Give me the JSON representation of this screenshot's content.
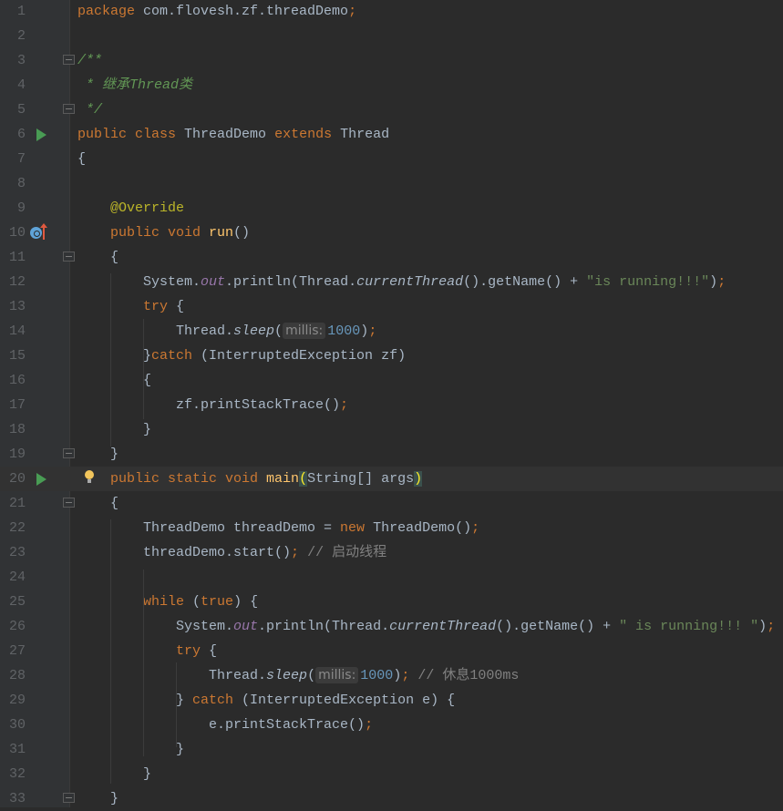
{
  "editor": {
    "current_line": 20,
    "lines": [
      {
        "n": "1",
        "tokens": [
          {
            "t": "package ",
            "c": "k"
          },
          {
            "t": "com.flovesh.zf.threadDemo",
            "c": "d"
          },
          {
            "t": ";",
            "c": "semi"
          }
        ]
      },
      {
        "n": "2",
        "tokens": []
      },
      {
        "n": "3",
        "fold": true,
        "tokens": [
          {
            "t": "/**",
            "c": "c"
          }
        ]
      },
      {
        "n": "4",
        "tokens": [
          {
            "t": " * 继承Thread类",
            "c": "c"
          }
        ]
      },
      {
        "n": "5",
        "fold": true,
        "tokens": [
          {
            "t": " */",
            "c": "c"
          }
        ]
      },
      {
        "n": "6",
        "run": true,
        "tokens": [
          {
            "t": "public class ",
            "c": "k"
          },
          {
            "t": "ThreadDemo ",
            "c": "d"
          },
          {
            "t": "extends ",
            "c": "k"
          },
          {
            "t": "Thread",
            "c": "d"
          }
        ]
      },
      {
        "n": "7",
        "tokens": [
          {
            "t": "{",
            "c": "d"
          }
        ]
      },
      {
        "n": "8",
        "tokens": []
      },
      {
        "n": "9",
        "tokens": [
          {
            "t": "    ",
            "c": "d"
          },
          {
            "t": "@Override",
            "c": "a"
          }
        ]
      },
      {
        "n": "10",
        "override": true,
        "tokens": [
          {
            "t": "    public void ",
            "c": "k"
          },
          {
            "t": "run",
            "c": "f"
          },
          {
            "t": "()",
            "c": "d"
          }
        ]
      },
      {
        "n": "11",
        "fold": true,
        "tokens": [
          {
            "t": "    {",
            "c": "d"
          }
        ]
      },
      {
        "n": "12",
        "tokens": [
          {
            "t": "        System.",
            "c": "d"
          },
          {
            "t": "out",
            "c": "sf"
          },
          {
            "t": ".println(Thread.",
            "c": "d"
          },
          {
            "t": "currentThread",
            "c": "sm"
          },
          {
            "t": "().getName() + ",
            "c": "d"
          },
          {
            "t": "\"is running!!!\"",
            "c": "s"
          },
          {
            "t": ")",
            "c": "d"
          },
          {
            "t": ";",
            "c": "semi"
          }
        ]
      },
      {
        "n": "13",
        "tokens": [
          {
            "t": "        try ",
            "c": "k"
          },
          {
            "t": "{",
            "c": "d"
          }
        ]
      },
      {
        "n": "14",
        "tokens": [
          {
            "t": "            Thread.",
            "c": "d"
          },
          {
            "t": "sleep",
            "c": "sm"
          },
          {
            "t": "(",
            "c": "d"
          },
          {
            "t": "millis:",
            "c": "hint"
          },
          {
            "t": "1000",
            "c": "n"
          },
          {
            "t": ")",
            "c": "d"
          },
          {
            "t": ";",
            "c": "semi"
          }
        ]
      },
      {
        "n": "15",
        "tokens": [
          {
            "t": "        }",
            "c": "d"
          },
          {
            "t": "catch ",
            "c": "k"
          },
          {
            "t": "(InterruptedException zf)",
            "c": "d"
          }
        ]
      },
      {
        "n": "16",
        "tokens": [
          {
            "t": "        {",
            "c": "d"
          }
        ]
      },
      {
        "n": "17",
        "tokens": [
          {
            "t": "            zf.printStackTrace()",
            "c": "d"
          },
          {
            "t": ";",
            "c": "semi"
          }
        ]
      },
      {
        "n": "18",
        "tokens": [
          {
            "t": "        }",
            "c": "d"
          }
        ]
      },
      {
        "n": "19",
        "fold": true,
        "tokens": [
          {
            "t": "    }",
            "c": "d"
          }
        ]
      },
      {
        "n": "20",
        "run": true,
        "bulb": true,
        "tokens": [
          {
            "t": "    public static void ",
            "c": "k"
          },
          {
            "t": "main",
            "c": "f"
          },
          {
            "t": "(",
            "c": "bm"
          },
          {
            "t": "String[] args",
            "c": "d"
          },
          {
            "t": ")",
            "c": "bm"
          }
        ]
      },
      {
        "n": "21",
        "fold": true,
        "tokens": [
          {
            "t": "    {",
            "c": "d"
          }
        ]
      },
      {
        "n": "22",
        "tokens": [
          {
            "t": "        ThreadDemo threadDemo = ",
            "c": "d"
          },
          {
            "t": "new ",
            "c": "k"
          },
          {
            "t": "ThreadDemo()",
            "c": "d"
          },
          {
            "t": ";",
            "c": "semi"
          }
        ]
      },
      {
        "n": "23",
        "tokens": [
          {
            "t": "        threadDemo.start()",
            "c": "d"
          },
          {
            "t": "; ",
            "c": "semi"
          },
          {
            "t": "// 启动线程",
            "c": "lc"
          }
        ]
      },
      {
        "n": "24",
        "tokens": []
      },
      {
        "n": "25",
        "tokens": [
          {
            "t": "        ",
            "c": "d"
          },
          {
            "t": "while",
            "c": "k"
          },
          {
            "t": " (",
            "c": "d"
          },
          {
            "t": "true",
            "c": "k"
          },
          {
            "t": ") {",
            "c": "d"
          }
        ]
      },
      {
        "n": "26",
        "tokens": [
          {
            "t": "            System.",
            "c": "d"
          },
          {
            "t": "out",
            "c": "sf"
          },
          {
            "t": ".println(Thread.",
            "c": "d"
          },
          {
            "t": "currentThread",
            "c": "sm"
          },
          {
            "t": "().getName() + ",
            "c": "d"
          },
          {
            "t": "\" is running!!! \"",
            "c": "s"
          },
          {
            "t": ")",
            "c": "d"
          },
          {
            "t": ";",
            "c": "semi"
          }
        ]
      },
      {
        "n": "27",
        "tokens": [
          {
            "t": "            try ",
            "c": "k"
          },
          {
            "t": "{",
            "c": "d"
          }
        ]
      },
      {
        "n": "28",
        "tokens": [
          {
            "t": "                Thread.",
            "c": "d"
          },
          {
            "t": "sleep",
            "c": "sm"
          },
          {
            "t": "(",
            "c": "d"
          },
          {
            "t": "millis:",
            "c": "hint"
          },
          {
            "t": "1000",
            "c": "n"
          },
          {
            "t": ")",
            "c": "d"
          },
          {
            "t": "; ",
            "c": "semi"
          },
          {
            "t": "// 休息1000ms",
            "c": "lc"
          }
        ]
      },
      {
        "n": "29",
        "tokens": [
          {
            "t": "            } ",
            "c": "d"
          },
          {
            "t": "catch ",
            "c": "k"
          },
          {
            "t": "(InterruptedException e) {",
            "c": "d"
          }
        ]
      },
      {
        "n": "30",
        "tokens": [
          {
            "t": "                e.printStackTrace()",
            "c": "d"
          },
          {
            "t": ";",
            "c": "semi"
          }
        ]
      },
      {
        "n": "31",
        "tokens": [
          {
            "t": "            }",
            "c": "d"
          }
        ]
      },
      {
        "n": "32",
        "tokens": [
          {
            "t": "        }",
            "c": "d"
          }
        ]
      },
      {
        "n": "33",
        "fold": true,
        "tokens": [
          {
            "t": "    }",
            "c": "d"
          }
        ]
      }
    ]
  }
}
